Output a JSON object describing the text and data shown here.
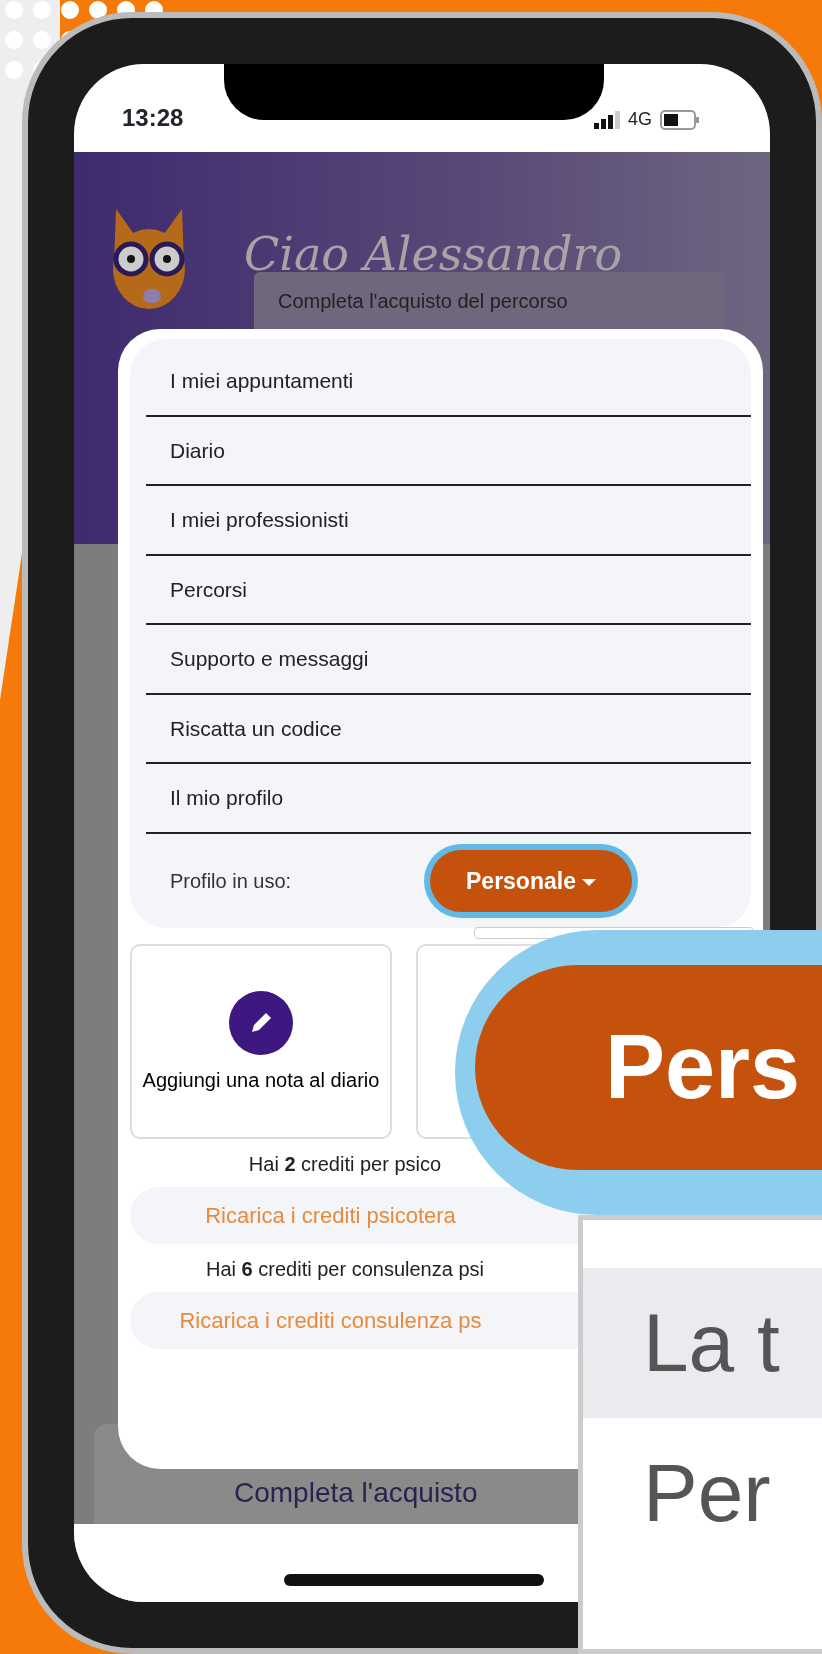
{
  "status_bar": {
    "time": "13:28",
    "network": "4G"
  },
  "header": {
    "greeting": "Ciao Alessandro",
    "banner": "Completa l'acquisto del percorso"
  },
  "menu": {
    "items": [
      {
        "label": "I miei appuntamenti"
      },
      {
        "label": "Diario"
      },
      {
        "label": "I miei professionisti"
      },
      {
        "label": "Percorsi"
      },
      {
        "label": "Supporto e messaggi"
      },
      {
        "label": "Riscatta un codice"
      },
      {
        "label": "Il mio profilo"
      }
    ],
    "profile_label": "Profilo in uso:",
    "profile_button": "Personale",
    "profile_expanded": true
  },
  "actions": [
    {
      "label": "Aggiungi una nota al diario"
    }
  ],
  "credits": [
    {
      "text": "Hai **2** crediti per psico",
      "button": "Ricarica i crediti psicotera"
    },
    {
      "text": "Hai **6** crediti per consulenza psi",
      "button": "Ricarica i crediti consulenza ps"
    }
  ],
  "background_text": "Completa l'acquisto",
  "zoom_callout": {
    "button": "Pers",
    "options": [
      {
        "label": "La t",
        "selected": true
      },
      {
        "label": "Per",
        "selected": false
      }
    ]
  }
}
